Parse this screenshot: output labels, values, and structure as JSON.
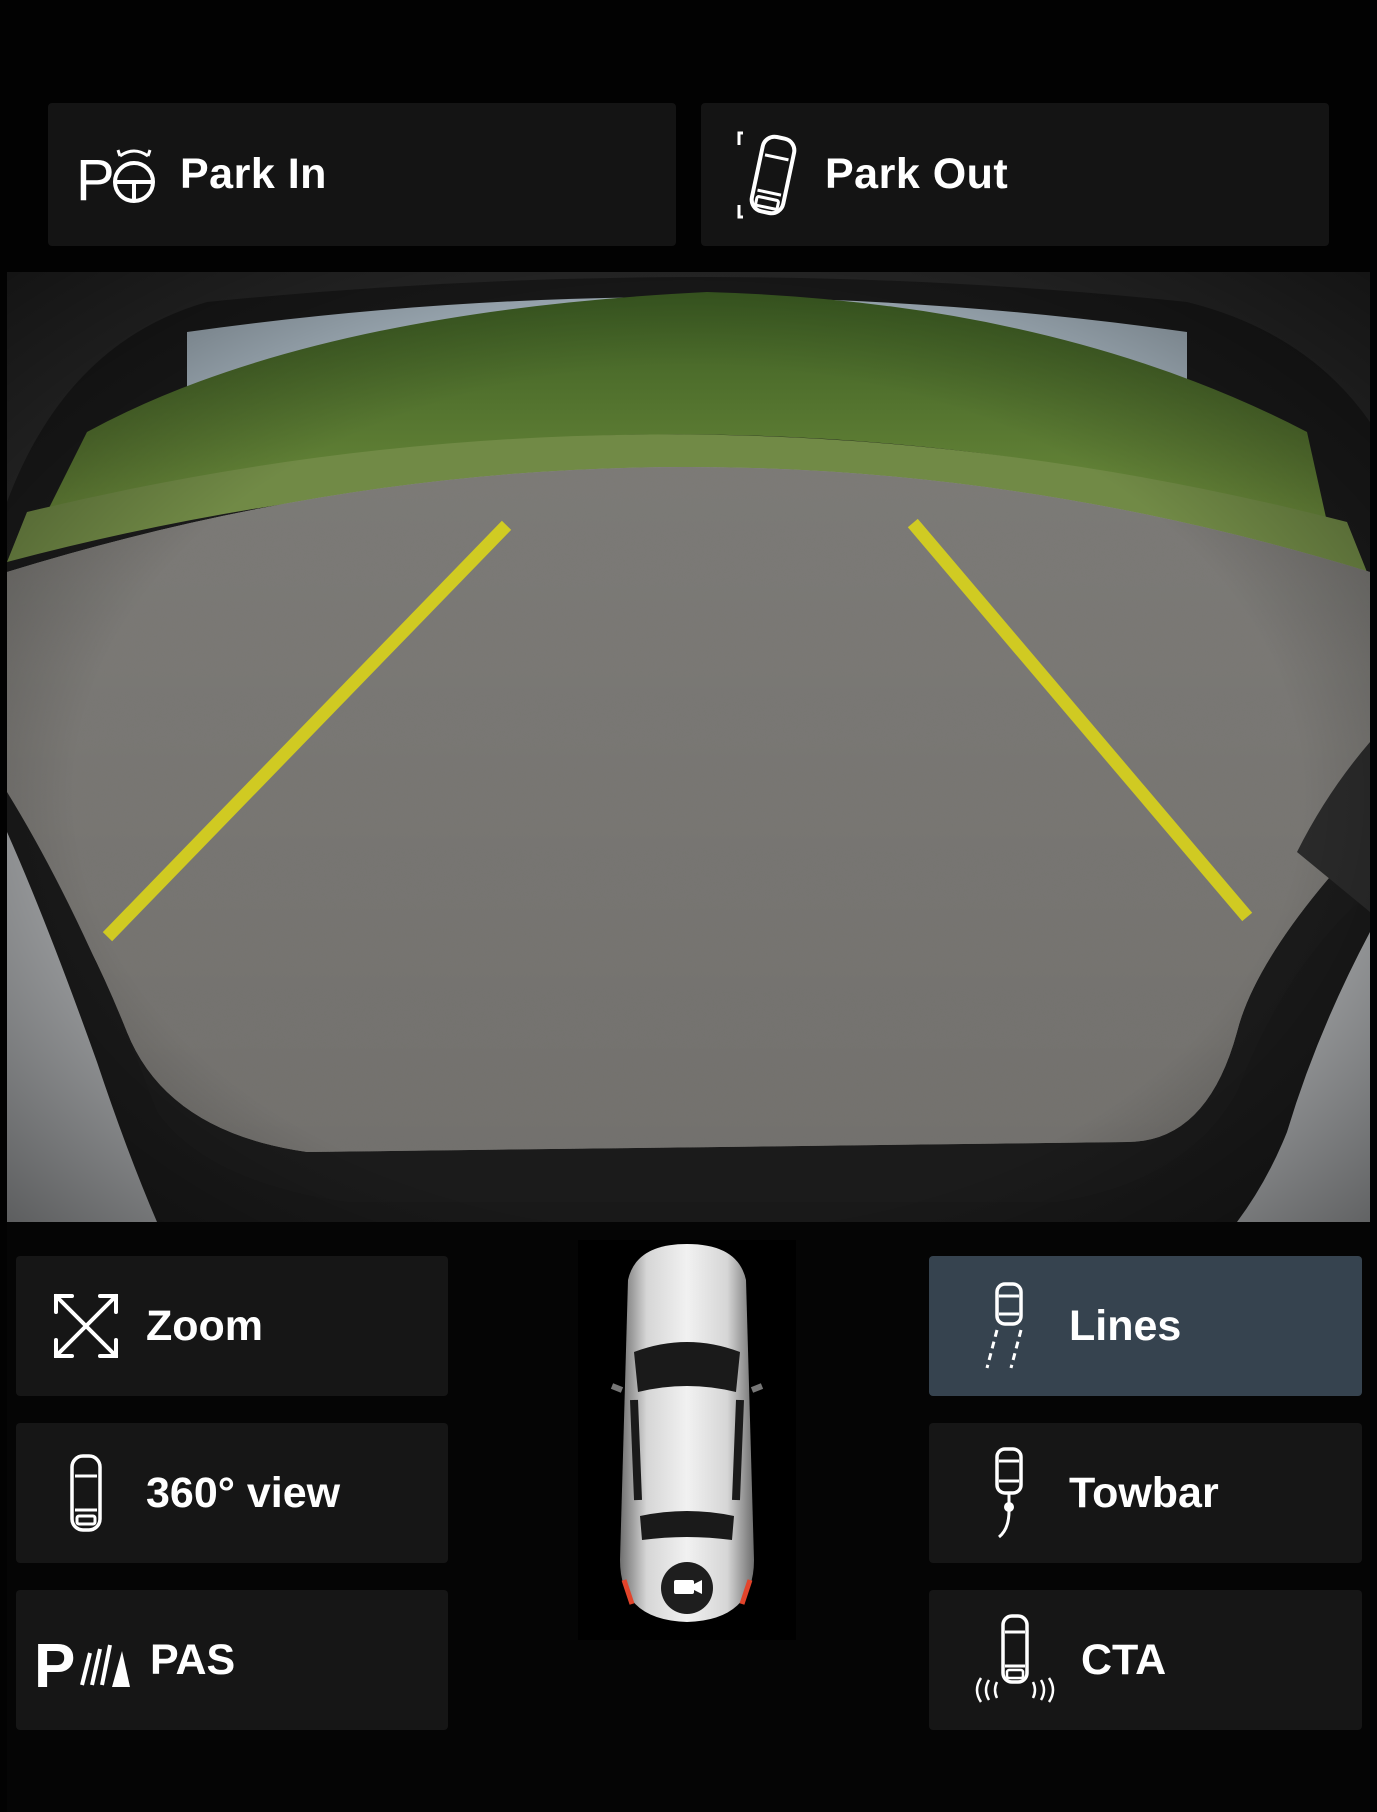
{
  "top_bar": {
    "park_in_label": "Park In",
    "park_out_label": "Park Out"
  },
  "camera": {
    "view": "rear camera",
    "guide_line_color": "#d8d21c"
  },
  "controls": {
    "zoom_label": "Zoom",
    "view_360_label": "360° view",
    "pas_label": "PAS",
    "lines_label": "Lines",
    "towbar_label": "Towbar",
    "cta_label": "CTA",
    "active_button": "Lines"
  },
  "icons": {
    "park_in": "park-assist-steering-icon",
    "park_out": "car-park-out-icon",
    "zoom": "expand-arrows-icon",
    "view_360": "car-top-view-icon",
    "pas": "parking-sensor-icon",
    "lines": "car-guide-lines-icon",
    "towbar": "car-towbar-icon",
    "cta": "cross-traffic-alert-icon",
    "car": "car-camera-icon"
  },
  "colors": {
    "active_bg": "#36434f",
    "button_bg": "#161616",
    "tail_light": "#e2442b"
  }
}
